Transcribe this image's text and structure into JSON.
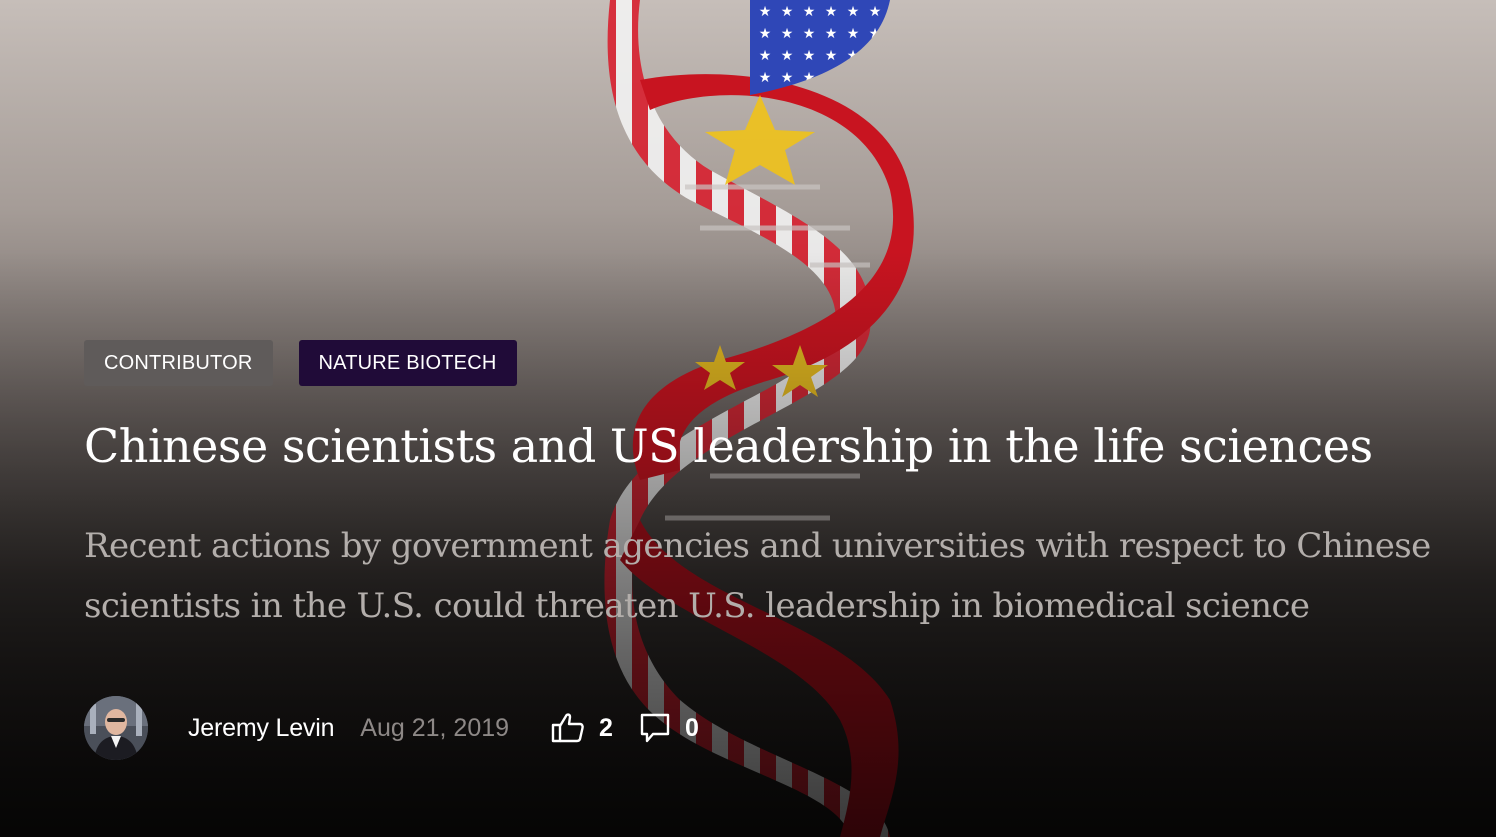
{
  "hero": {
    "image": "dna-helix-us-china-flags",
    "tags": {
      "contributor": "CONTRIBUTOR",
      "nature": "NATURE BIOTECH"
    },
    "title": "Chinese scientists and US leadership in the life sciences",
    "subtitle": "Recent actions by government agencies and universities with respect to Chinese scientists in the U.S. could threaten U.S. leadership in biomedical science"
  },
  "meta": {
    "author": "Jeremy Levin",
    "date": "Aug 21, 2019",
    "likes": "2",
    "comments": "0",
    "like_icon": "thumbs-up-icon",
    "comment_icon": "comment-icon"
  },
  "colors": {
    "tag_contributor": "#5f5b5a",
    "tag_nature": "#200b38",
    "title": "#ffffff",
    "subtitle": "#b3aeab"
  }
}
